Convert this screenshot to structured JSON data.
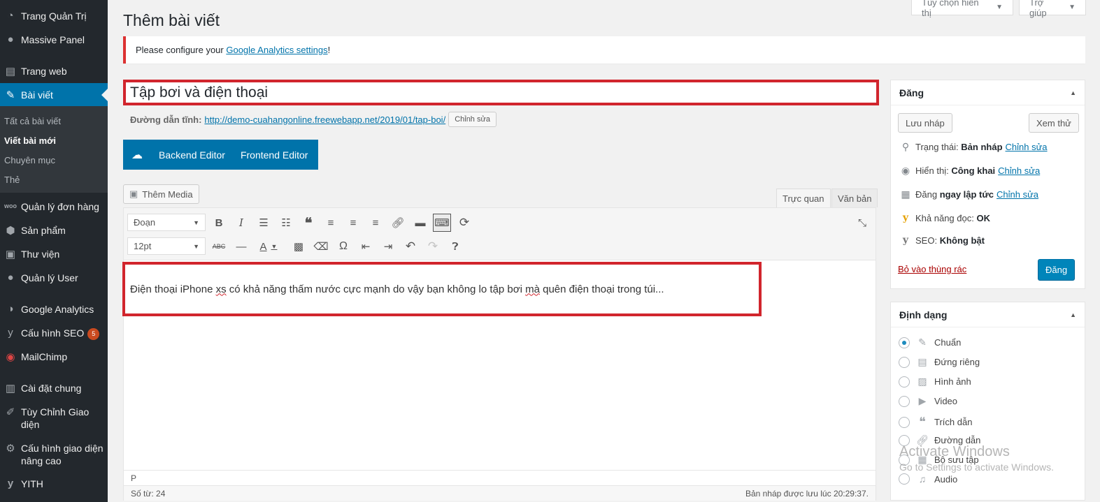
{
  "sidebar": {
    "items": [
      {
        "label": "Trang Quản Trị",
        "icon": "dashboard-icon"
      },
      {
        "label": "Massive Panel",
        "icon": "lightbulb-icon"
      },
      {
        "label": "Trang web",
        "icon": "pages-icon"
      },
      {
        "label": "Bài viết",
        "icon": "pin-icon"
      },
      {
        "label": "Quản lý đơn hàng",
        "icon": "woo-icon"
      },
      {
        "label": "Sản phẩm",
        "icon": "box-icon"
      },
      {
        "label": "Thư viện",
        "icon": "media-icon"
      },
      {
        "label": "Quản lý User",
        "icon": "user-icon"
      },
      {
        "label": "Google Analytics",
        "icon": "analytics-icon"
      },
      {
        "label": "Cấu hình SEO",
        "icon": "yoast-icon",
        "badge": "5"
      },
      {
        "label": "MailChimp",
        "icon": "mailchimp-icon"
      },
      {
        "label": "Cài đặt chung",
        "icon": "settings-icon"
      },
      {
        "label": "Tùy Chỉnh Giao diện",
        "icon": "brush-icon"
      },
      {
        "label": "Cấu hình giao diện nâng cao",
        "icon": "gear-icon"
      },
      {
        "label": "YITH",
        "icon": "yith-icon"
      }
    ],
    "submenu": [
      "Tất cả bài viết",
      "Viết bài mới",
      "Chuyên mục",
      "Thẻ"
    ]
  },
  "header": {
    "screen_options": "Tùy chọn hiển thị",
    "help": "Trợ giúp",
    "page_title": "Thêm bài viết"
  },
  "notice": {
    "prefix": "Please configure your ",
    "link": "Google Analytics settings",
    "suffix": "!"
  },
  "post": {
    "title": "Tập bơi và điện thoại",
    "permalink_label": "Đường dẫn tĩnh:",
    "permalink_url": "http://demo-cuahangonline.freewebapp.net/2019/01/tap-boi/",
    "permalink_edit": "Chỉnh sửa"
  },
  "vc": {
    "backend": "Backend Editor",
    "frontend": "Frontend Editor"
  },
  "editor": {
    "add_media": "Thêm Media",
    "tab_visual": "Trực quan",
    "tab_text": "Văn bản",
    "format_select": "Đoạn",
    "size_select": "12pt",
    "content_part1": "Điện thoại iPhone ",
    "content_sp1": "xs",
    "content_part2": " có khả năng thấm nước cực mạnh do vậy bạn không lo tập bơi ",
    "content_sp2": "mà",
    "content_part3": " quên điện thoại trong túi...",
    "path": "P",
    "word_count": "Số từ: 24",
    "saved": "Bản nháp được lưu lúc 20:29:37."
  },
  "publish": {
    "title": "Đăng",
    "save_draft": "Lưu nháp",
    "preview": "Xem thử",
    "status_label": "Trạng thái:",
    "status_value": "Bản nháp",
    "visibility_label": "Hiển thị:",
    "visibility_value": "Công khai",
    "schedule_label": "Đăng",
    "schedule_value": "ngay lập tức",
    "edit": "Chỉnh sửa",
    "readability": "Khả năng đọc:",
    "readability_value": "OK",
    "seo": "SEO:",
    "seo_value": "Không bật",
    "trash": "Bỏ vào thùng rác",
    "publish_btn": "Đăng"
  },
  "format": {
    "title": "Định dạng",
    "options": [
      "Chuẩn",
      "Đứng riêng",
      "Hình ảnh",
      "Video",
      "Trích dẫn",
      "Đường dẫn",
      "Bộ sưu tập",
      "Audio"
    ],
    "selected": "Chuẩn"
  },
  "watermark": {
    "line1": "Activate Windows",
    "line2": "Go to Settings to activate Windows."
  },
  "colors": {
    "sidebar": "#23282d",
    "accent": "#0073aa",
    "highlight_border": "#d1252d"
  }
}
